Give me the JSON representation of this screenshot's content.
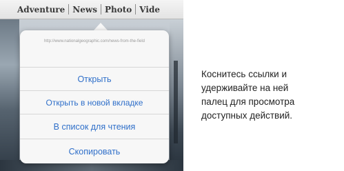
{
  "nav": {
    "links": [
      "Adventure",
      "News",
      "Photo",
      "Vide"
    ]
  },
  "popover": {
    "url_text": "http://www.nationalgeographic.com/news-from-the-field",
    "actions": [
      "Открыть",
      "Открыть в новой вкладке",
      "В список для чтения",
      "Скопировать"
    ]
  },
  "caption": {
    "lines": [
      "Коснитесь ссылки и",
      "удерживайте на ней",
      "палец для просмотра",
      "доступных действий."
    ]
  }
}
